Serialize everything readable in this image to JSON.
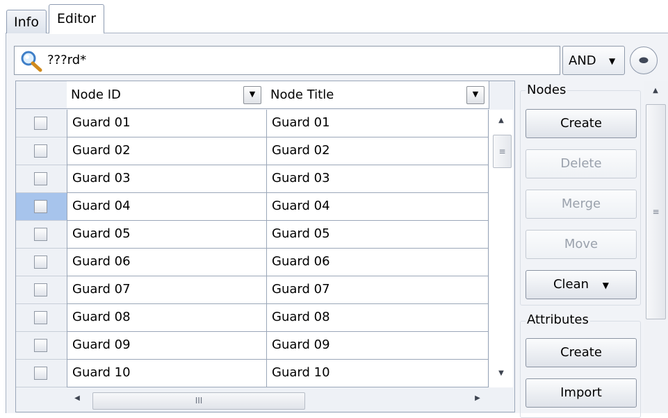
{
  "tabs": [
    {
      "label": "Info"
    },
    {
      "label": "Editor"
    }
  ],
  "search": {
    "value": "???rd*",
    "operator": "AND"
  },
  "grid": {
    "columns": [
      "Node ID",
      "Node Title"
    ],
    "rows": [
      {
        "id": "Guard 01",
        "title": "Guard 01",
        "checked": false
      },
      {
        "id": "Guard 02",
        "title": "Guard 02",
        "checked": false
      },
      {
        "id": "Guard 03",
        "title": "Guard 03",
        "checked": false
      },
      {
        "id": "Guard 04",
        "title": "Guard 04",
        "checked": false,
        "selected": true
      },
      {
        "id": "Guard 05",
        "title": "Guard 05",
        "checked": false
      },
      {
        "id": "Guard 06",
        "title": "Guard 06",
        "checked": false
      },
      {
        "id": "Guard 07",
        "title": "Guard 07",
        "checked": false
      },
      {
        "id": "Guard 08",
        "title": "Guard 08",
        "checked": false
      },
      {
        "id": "Guard 09",
        "title": "Guard 09",
        "checked": false
      },
      {
        "id": "Guard 10",
        "title": "Guard 10",
        "checked": false
      }
    ]
  },
  "nodes": {
    "title": "Nodes",
    "create": "Create",
    "delete": "Delete",
    "merge": "Merge",
    "move": "Move",
    "clean": "Clean"
  },
  "attributes": {
    "title": "Attributes",
    "create": "Create",
    "import": "Import"
  },
  "colors": {
    "selected_cell": "#a7c4ec",
    "panel_bg": "#f1f3f7",
    "disabled_text": "#9aa1ac"
  },
  "icons": {
    "search": "magnifier-icon",
    "expand": "double-chevron-down-icon",
    "dropdown": "triangle-down-icon"
  }
}
